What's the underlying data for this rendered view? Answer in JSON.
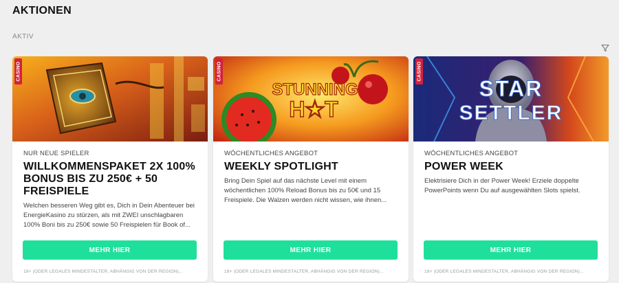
{
  "page": {
    "title": "AKTIONEN",
    "section_label": "AKTIV"
  },
  "icons": {
    "filter": "filter-icon"
  },
  "colors": {
    "cta": "#1fe09b",
    "casino_tag": "#d3213b",
    "background": "#efefef"
  },
  "cards": [
    {
      "tag": "CASINO",
      "eyebrow": "NUR NEUE SPIELER",
      "title": "WILLKOMMENSPAKET 2X 100% BONUS BIS ZU 250€ + 50 FREISPIELE",
      "description": "Welchen besseren Weg gibt es, Dich in Dein Abenteuer bei EnergieKasino zu stürzen, als mit ZWEI unschlagbaren 100% Boni bis zu 250€ sowie 50 Freispielen für Book of...",
      "cta": "MEHR HIER",
      "disclaimer": "18+ (ODER LEGALES MINDESTALTER, ABHÄNGIG VON DER REGION)..."
    },
    {
      "tag": "CASINO",
      "eyebrow": "WÖCHENTLICHES ANGEBOT",
      "title": "WEEKLY SPOTLIGHT",
      "banner_logo_line1": "STUNNING",
      "banner_logo_line2": "H★T",
      "description": "Bring Dein Spiel auf das nächste Level mit einem wöchentlichen 100% Reload Bonus bis zu 50€ und 15 Freispiele. Die Walzen werden nicht wissen, wie ihnen...",
      "cta": "MEHR HIER",
      "disclaimer": "18+ (ODER LEGALES MINDESTALTER, ABHÄNGIG VON DER REGION)..."
    },
    {
      "tag": "CASINO",
      "eyebrow": "WÖCHENTLICHES ANGEBOT",
      "title": "POWER WEEK",
      "banner_logo_line1": "STAR",
      "banner_logo_line2": "SETTLER",
      "description": "Elektrisiere Dich in der Power Week! Erziele doppelte PowerPoints wenn Du auf ausgewählten Slots spielst.",
      "cta": "MEHR HIER",
      "disclaimer": "18+ (ODER LEGALES MINDESTALTER, ABHÄNGIG VON DER REGION)..."
    }
  ]
}
